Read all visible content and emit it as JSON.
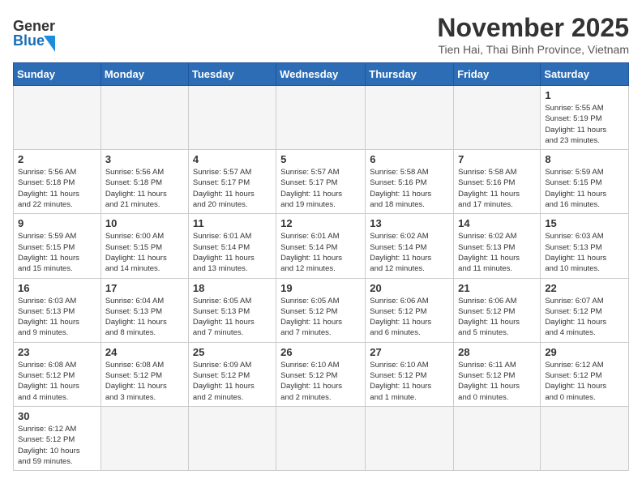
{
  "header": {
    "logo_general": "General",
    "logo_blue": "Blue",
    "month_title": "November 2025",
    "subtitle": "Tien Hai, Thai Binh Province, Vietnam"
  },
  "days_of_week": [
    "Sunday",
    "Monday",
    "Tuesday",
    "Wednesday",
    "Thursday",
    "Friday",
    "Saturday"
  ],
  "weeks": [
    [
      {
        "day": "",
        "info": ""
      },
      {
        "day": "",
        "info": ""
      },
      {
        "day": "",
        "info": ""
      },
      {
        "day": "",
        "info": ""
      },
      {
        "day": "",
        "info": ""
      },
      {
        "day": "",
        "info": ""
      },
      {
        "day": "1",
        "info": "Sunrise: 5:55 AM\nSunset: 5:19 PM\nDaylight: 11 hours\nand 23 minutes."
      }
    ],
    [
      {
        "day": "2",
        "info": "Sunrise: 5:56 AM\nSunset: 5:18 PM\nDaylight: 11 hours\nand 22 minutes."
      },
      {
        "day": "3",
        "info": "Sunrise: 5:56 AM\nSunset: 5:18 PM\nDaylight: 11 hours\nand 21 minutes."
      },
      {
        "day": "4",
        "info": "Sunrise: 5:57 AM\nSunset: 5:17 PM\nDaylight: 11 hours\nand 20 minutes."
      },
      {
        "day": "5",
        "info": "Sunrise: 5:57 AM\nSunset: 5:17 PM\nDaylight: 11 hours\nand 19 minutes."
      },
      {
        "day": "6",
        "info": "Sunrise: 5:58 AM\nSunset: 5:16 PM\nDaylight: 11 hours\nand 18 minutes."
      },
      {
        "day": "7",
        "info": "Sunrise: 5:58 AM\nSunset: 5:16 PM\nDaylight: 11 hours\nand 17 minutes."
      },
      {
        "day": "8",
        "info": "Sunrise: 5:59 AM\nSunset: 5:15 PM\nDaylight: 11 hours\nand 16 minutes."
      }
    ],
    [
      {
        "day": "9",
        "info": "Sunrise: 5:59 AM\nSunset: 5:15 PM\nDaylight: 11 hours\nand 15 minutes."
      },
      {
        "day": "10",
        "info": "Sunrise: 6:00 AM\nSunset: 5:15 PM\nDaylight: 11 hours\nand 14 minutes."
      },
      {
        "day": "11",
        "info": "Sunrise: 6:01 AM\nSunset: 5:14 PM\nDaylight: 11 hours\nand 13 minutes."
      },
      {
        "day": "12",
        "info": "Sunrise: 6:01 AM\nSunset: 5:14 PM\nDaylight: 11 hours\nand 12 minutes."
      },
      {
        "day": "13",
        "info": "Sunrise: 6:02 AM\nSunset: 5:14 PM\nDaylight: 11 hours\nand 12 minutes."
      },
      {
        "day": "14",
        "info": "Sunrise: 6:02 AM\nSunset: 5:13 PM\nDaylight: 11 hours\nand 11 minutes."
      },
      {
        "day": "15",
        "info": "Sunrise: 6:03 AM\nSunset: 5:13 PM\nDaylight: 11 hours\nand 10 minutes."
      }
    ],
    [
      {
        "day": "16",
        "info": "Sunrise: 6:03 AM\nSunset: 5:13 PM\nDaylight: 11 hours\nand 9 minutes."
      },
      {
        "day": "17",
        "info": "Sunrise: 6:04 AM\nSunset: 5:13 PM\nDaylight: 11 hours\nand 8 minutes."
      },
      {
        "day": "18",
        "info": "Sunrise: 6:05 AM\nSunset: 5:13 PM\nDaylight: 11 hours\nand 7 minutes."
      },
      {
        "day": "19",
        "info": "Sunrise: 6:05 AM\nSunset: 5:12 PM\nDaylight: 11 hours\nand 7 minutes."
      },
      {
        "day": "20",
        "info": "Sunrise: 6:06 AM\nSunset: 5:12 PM\nDaylight: 11 hours\nand 6 minutes."
      },
      {
        "day": "21",
        "info": "Sunrise: 6:06 AM\nSunset: 5:12 PM\nDaylight: 11 hours\nand 5 minutes."
      },
      {
        "day": "22",
        "info": "Sunrise: 6:07 AM\nSunset: 5:12 PM\nDaylight: 11 hours\nand 4 minutes."
      }
    ],
    [
      {
        "day": "23",
        "info": "Sunrise: 6:08 AM\nSunset: 5:12 PM\nDaylight: 11 hours\nand 4 minutes."
      },
      {
        "day": "24",
        "info": "Sunrise: 6:08 AM\nSunset: 5:12 PM\nDaylight: 11 hours\nand 3 minutes."
      },
      {
        "day": "25",
        "info": "Sunrise: 6:09 AM\nSunset: 5:12 PM\nDaylight: 11 hours\nand 2 minutes."
      },
      {
        "day": "26",
        "info": "Sunrise: 6:10 AM\nSunset: 5:12 PM\nDaylight: 11 hours\nand 2 minutes."
      },
      {
        "day": "27",
        "info": "Sunrise: 6:10 AM\nSunset: 5:12 PM\nDaylight: 11 hours\nand 1 minute."
      },
      {
        "day": "28",
        "info": "Sunrise: 6:11 AM\nSunset: 5:12 PM\nDaylight: 11 hours\nand 0 minutes."
      },
      {
        "day": "29",
        "info": "Sunrise: 6:12 AM\nSunset: 5:12 PM\nDaylight: 11 hours\nand 0 minutes."
      }
    ],
    [
      {
        "day": "30",
        "info": "Sunrise: 6:12 AM\nSunset: 5:12 PM\nDaylight: 10 hours\nand 59 minutes."
      },
      {
        "day": "",
        "info": ""
      },
      {
        "day": "",
        "info": ""
      },
      {
        "day": "",
        "info": ""
      },
      {
        "day": "",
        "info": ""
      },
      {
        "day": "",
        "info": ""
      },
      {
        "day": "",
        "info": ""
      }
    ]
  ]
}
